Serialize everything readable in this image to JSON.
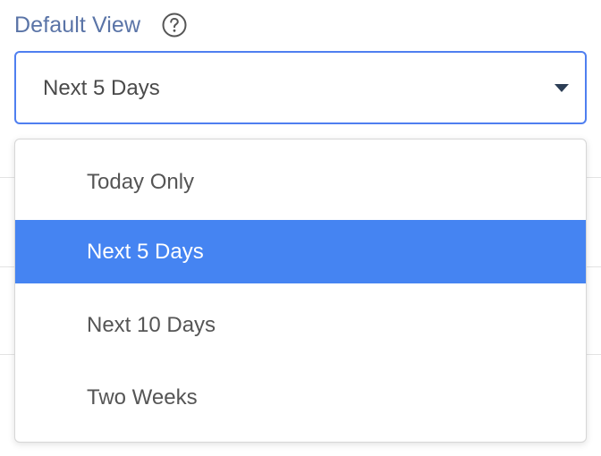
{
  "field": {
    "label": "Default View",
    "help_icon": "question-circle-icon",
    "selected_value": "Next 5 Days",
    "caret_icon": "caret-down-icon"
  },
  "dropdown": {
    "options": [
      {
        "label": "Today Only",
        "selected": false
      },
      {
        "label": "Next 5 Days",
        "selected": true
      },
      {
        "label": "Next 10 Days",
        "selected": false
      },
      {
        "label": "Two Weeks",
        "selected": false
      }
    ]
  },
  "colors": {
    "label_text": "#5a74a7",
    "focus_border": "#4f7ff0",
    "selected_bg": "#4584f2",
    "option_text": "#555555",
    "caret": "#2c3e55"
  }
}
